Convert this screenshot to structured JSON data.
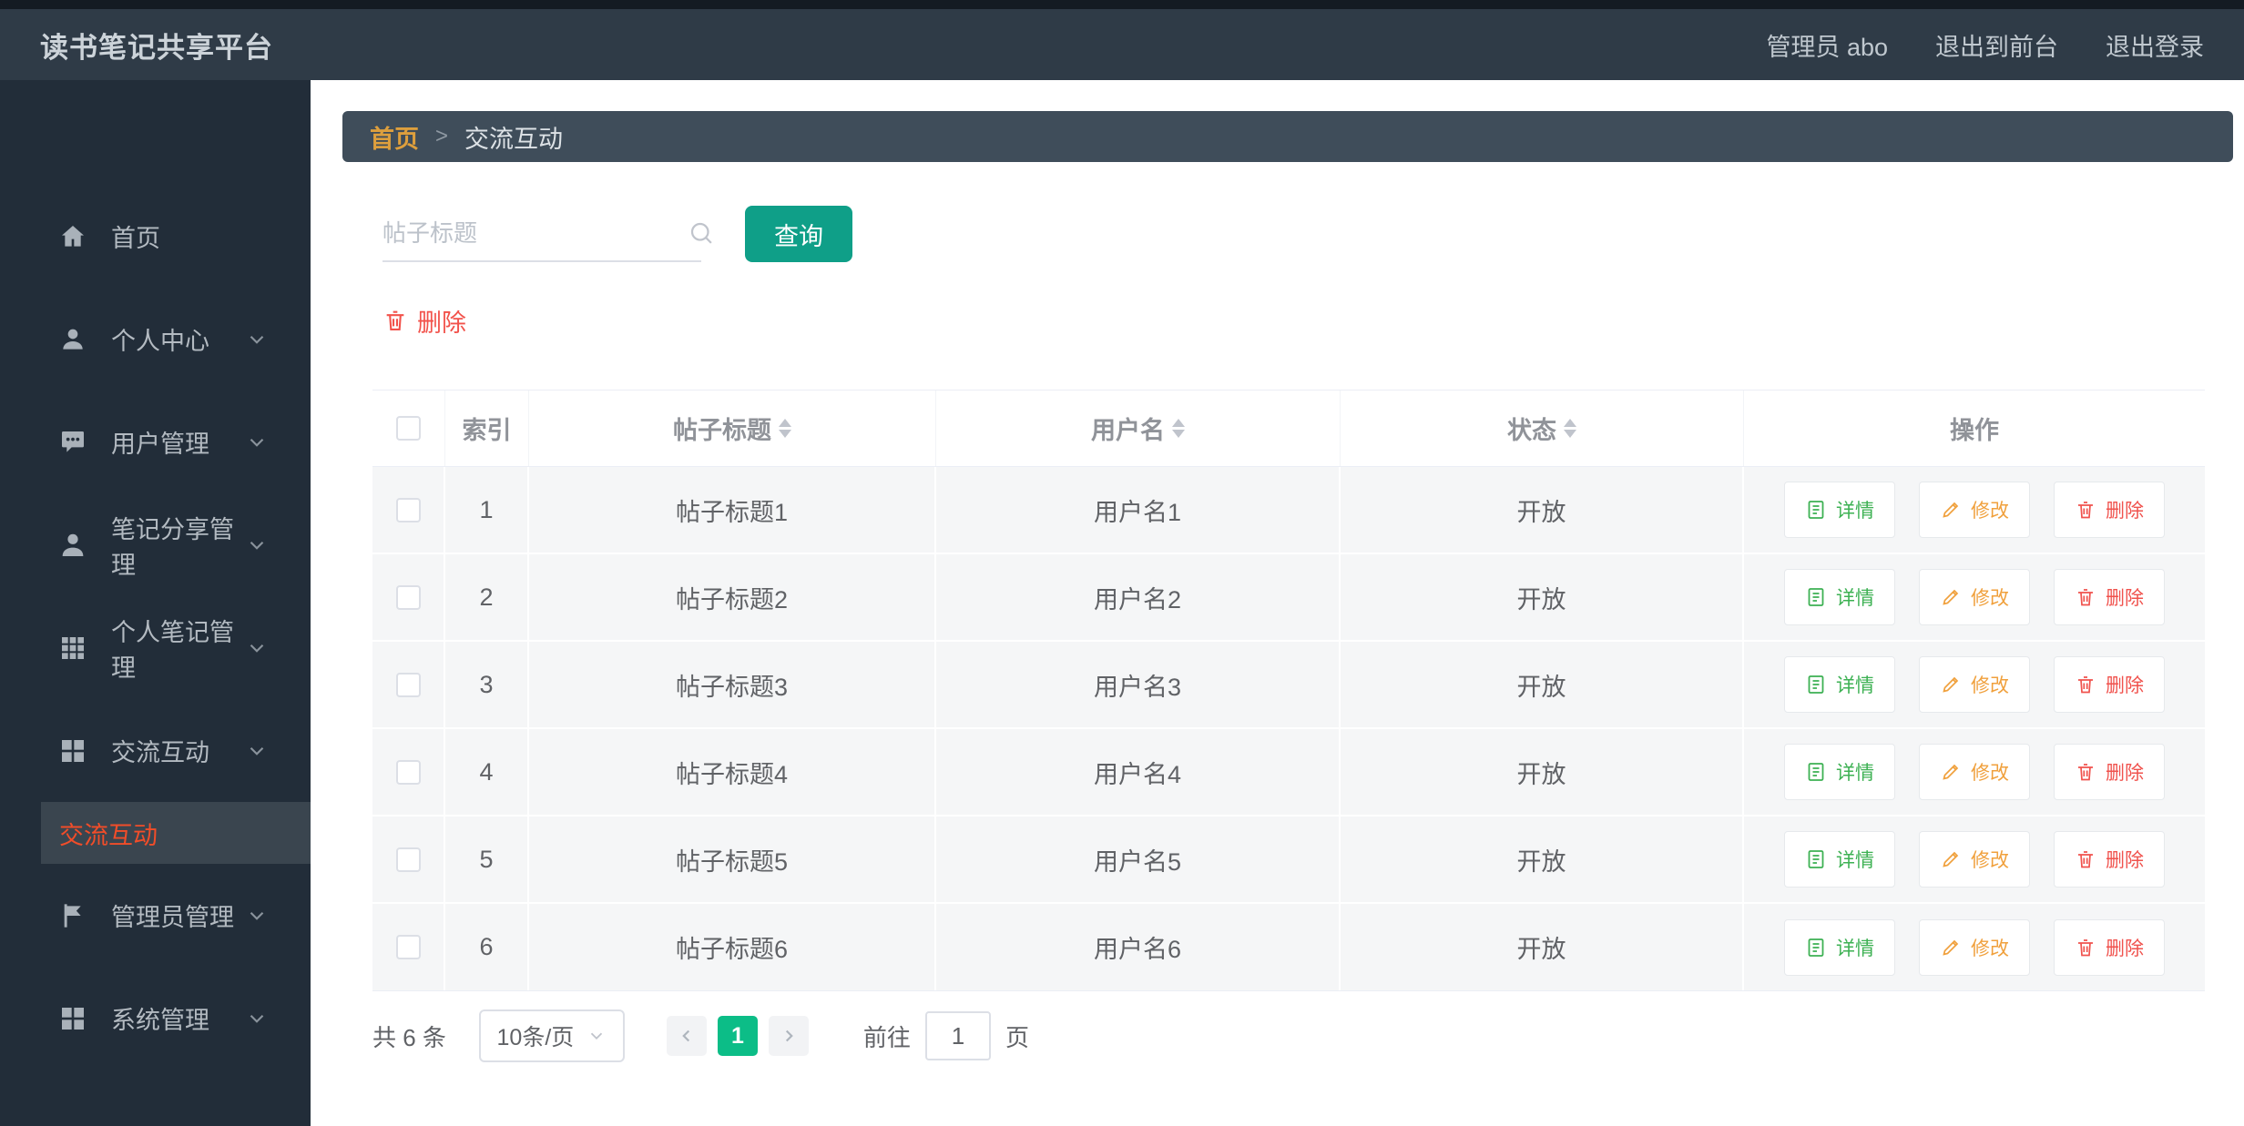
{
  "app": {
    "title": "读书笔记共享平台"
  },
  "header": {
    "user_label": "管理员 abo",
    "exit_front_label": "退出到前台",
    "logout_label": "退出登录"
  },
  "sidebar": {
    "items": [
      {
        "label": "首页",
        "icon": "home-icon",
        "has_children": false
      },
      {
        "label": "个人中心",
        "icon": "user-icon",
        "has_children": true
      },
      {
        "label": "用户管理",
        "icon": "chat-icon",
        "has_children": true
      },
      {
        "label": "笔记分享管理",
        "icon": "person-icon",
        "has_children": true
      },
      {
        "label": "个人笔记管理",
        "icon": "grid9-icon",
        "has_children": true
      },
      {
        "label": "交流互动",
        "icon": "grid4-icon",
        "has_children": true
      },
      {
        "label": "管理员管理",
        "icon": "flag-icon",
        "has_children": true
      },
      {
        "label": "系统管理",
        "icon": "grid4-icon",
        "has_children": true
      }
    ],
    "submenu": {
      "label": "交流互动",
      "active": true
    }
  },
  "breadcrumb": {
    "home_label": "首页",
    "separator": ">",
    "current_label": "交流互动"
  },
  "toolbar": {
    "search_placeholder": "帖子标题",
    "query_button_label": "查询",
    "delete_button_label": "删除"
  },
  "table": {
    "headers": {
      "index": "索引",
      "title": "帖子标题",
      "username": "用户名",
      "status": "状态",
      "actions": "操作"
    },
    "action_labels": {
      "detail": "详情",
      "edit": "修改",
      "delete": "删除"
    },
    "rows": [
      {
        "index": "1",
        "title": "帖子标题1",
        "username": "用户名1",
        "status": "开放"
      },
      {
        "index": "2",
        "title": "帖子标题2",
        "username": "用户名2",
        "status": "开放"
      },
      {
        "index": "3",
        "title": "帖子标题3",
        "username": "用户名3",
        "status": "开放"
      },
      {
        "index": "4",
        "title": "帖子标题4",
        "username": "用户名4",
        "status": "开放"
      },
      {
        "index": "5",
        "title": "帖子标题5",
        "username": "用户名5",
        "status": "开放"
      },
      {
        "index": "6",
        "title": "帖子标题6",
        "username": "用户名6",
        "status": "开放"
      }
    ]
  },
  "pagination": {
    "total_label": "共 6 条",
    "page_size_label": "10条/页",
    "current_page": "1",
    "goto_label": "前往",
    "goto_value": "1",
    "page_unit_label": "页"
  },
  "colors": {
    "header_bg": "#2f3b47",
    "sidebar_bg": "#222d39",
    "breadcrumb_bg": "#3f4d5a",
    "breadcrumb_home": "#dd9f3d",
    "active_menu_text": "#f14d29",
    "accent_teal": "#0f9f88",
    "pager_active_green": "#0cbd87",
    "success_green": "#3db153",
    "warning_orange": "#f0a03c",
    "danger_red": "#f0524d",
    "row_bg": "#f5f6f7"
  }
}
